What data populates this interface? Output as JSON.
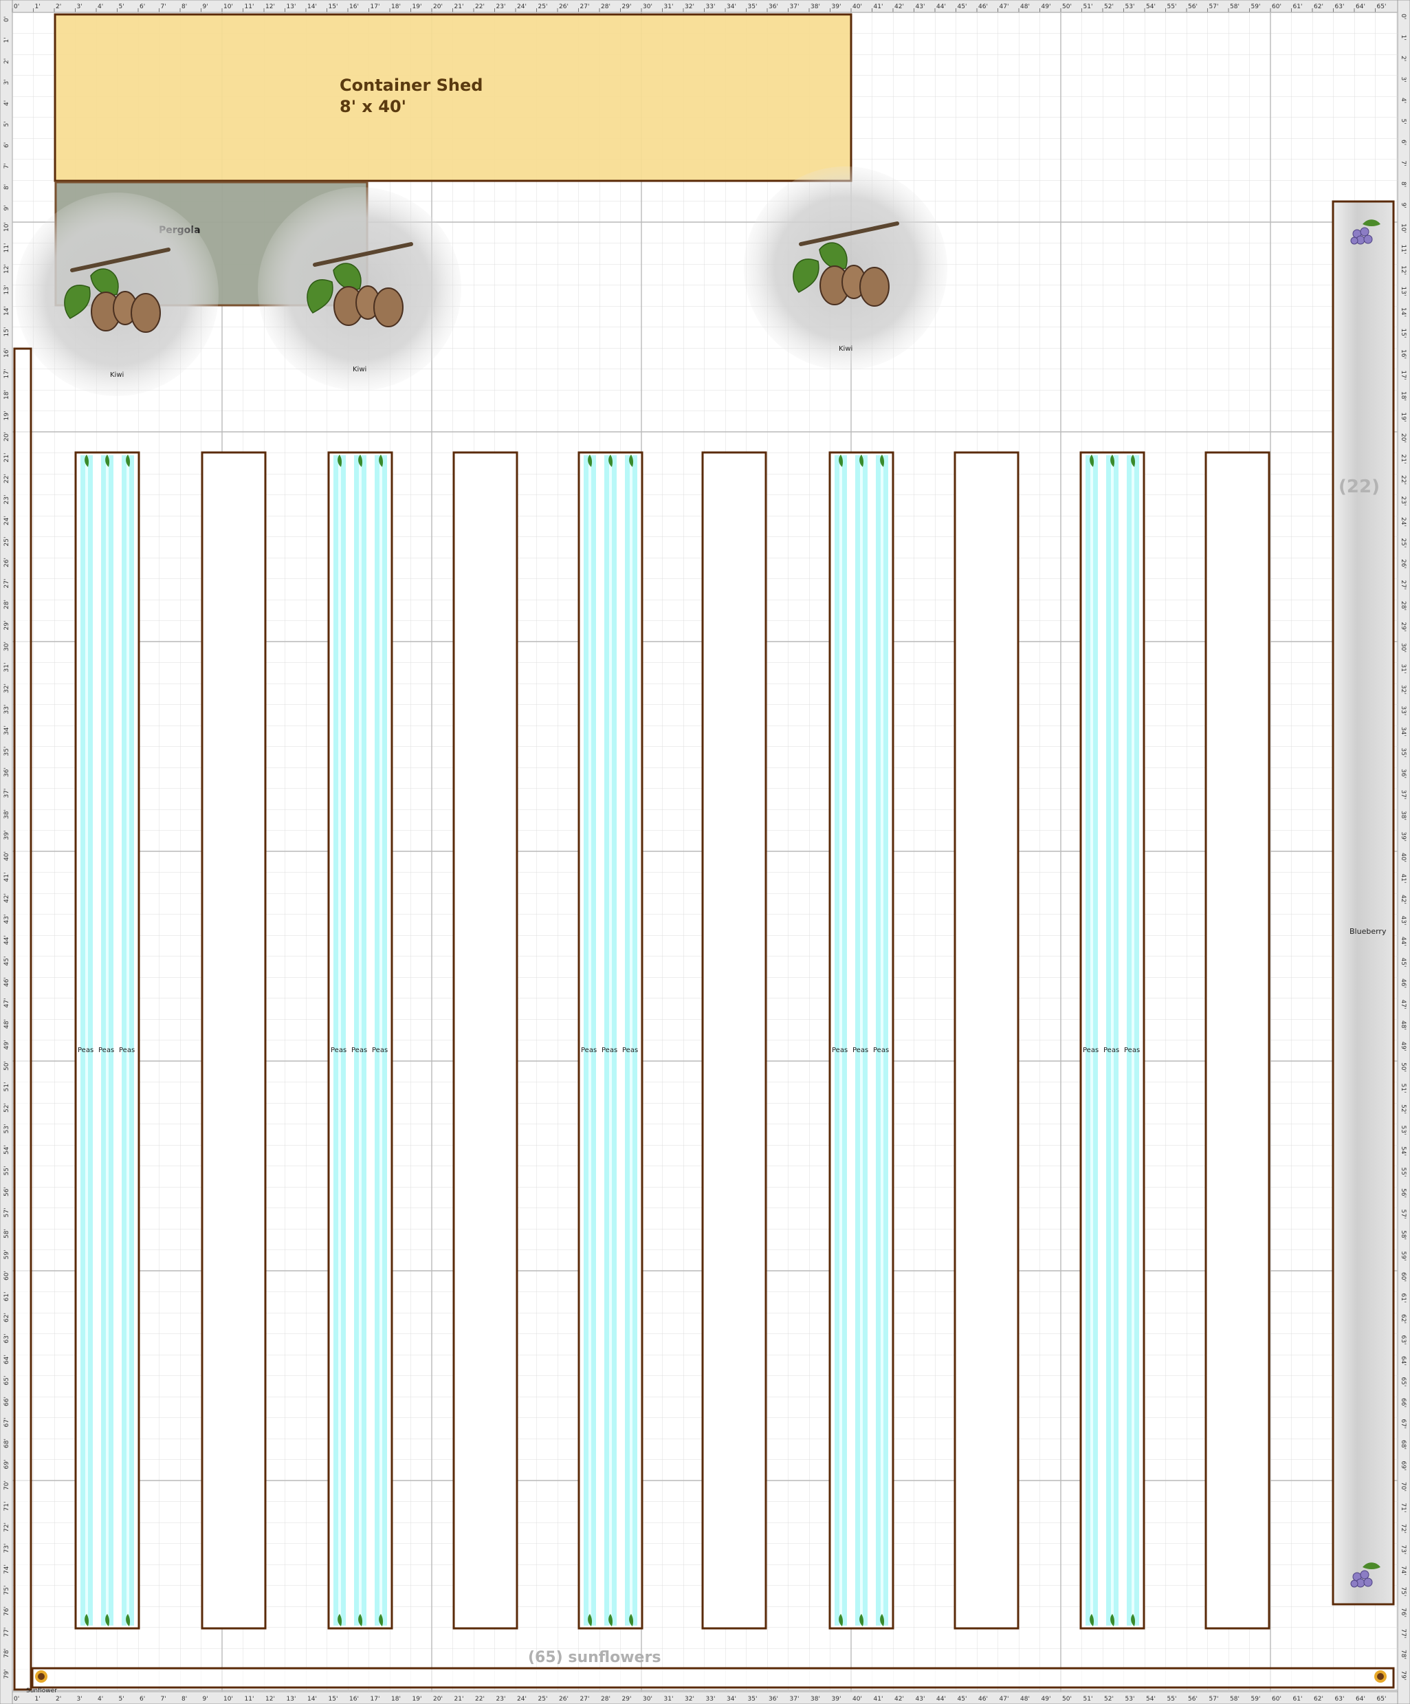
{
  "ruler": {
    "unit": "'",
    "top_ticks": [
      "0",
      "1",
      "2",
      "3",
      "4",
      "5",
      "6",
      "7",
      "8",
      "9",
      "10",
      "11",
      "12",
      "13",
      "14",
      "15",
      "16",
      "17",
      "18",
      "19",
      "20",
      "21",
      "22",
      "23",
      "24",
      "25",
      "26",
      "27",
      "28",
      "29",
      "30",
      "31",
      "32",
      "33",
      "34",
      "35",
      "36",
      "37",
      "38",
      "39",
      "40",
      "41",
      "42",
      "43",
      "44",
      "45",
      "46",
      "47",
      "48",
      "49",
      "50",
      "51",
      "52",
      "53",
      "54",
      "55",
      "56",
      "57",
      "58",
      "59",
      "60",
      "61",
      "62",
      "63",
      "64",
      "65"
    ],
    "side_ticks": [
      "0",
      "1",
      "2",
      "3",
      "4",
      "5",
      "6",
      "7",
      "8",
      "9",
      "10",
      "11",
      "12",
      "13",
      "14",
      "15",
      "16",
      "17",
      "18",
      "19",
      "20",
      "21",
      "22",
      "23",
      "24",
      "25",
      "26",
      "27",
      "28",
      "29",
      "30",
      "31",
      "32",
      "33",
      "34",
      "35",
      "36",
      "37",
      "38",
      "39",
      "40",
      "41",
      "42",
      "43",
      "44",
      "45",
      "46",
      "47",
      "48",
      "49",
      "50",
      "51",
      "52",
      "53",
      "54",
      "55",
      "56",
      "57",
      "58",
      "59",
      "60",
      "61",
      "62",
      "63",
      "64",
      "65",
      "66",
      "67",
      "68",
      "69",
      "70",
      "71",
      "72",
      "73",
      "74",
      "75",
      "76",
      "77",
      "78",
      "79"
    ]
  },
  "shed": {
    "title": "Container Shed",
    "size": "8' x 40'"
  },
  "pergola": {
    "label": "Pergola"
  },
  "kiwis": [
    {
      "label": "Kiwi"
    },
    {
      "label": "Kiwi"
    },
    {
      "label": "Kiwi"
    }
  ],
  "beds": {
    "planted_label": "Peas",
    "planted_count": 5,
    "empty_count": 5
  },
  "blueberry": {
    "label": "Blueberry",
    "count": "(22)"
  },
  "sunflowers": {
    "label": "(65) sunflowers",
    "plant_label": "Sunflower"
  },
  "colors": {
    "grid_minor": "#dcdcdc",
    "grid_major": "#b9b9b9",
    "bed_border": "#5a2a08",
    "shed_fill": "#f7dd91",
    "pergola_fill": "#a3a89a",
    "peas_stripe": "#b8f8f8",
    "blueberry_fill": "#d3d3d3",
    "kiwi_halo": "#cfcfcf"
  }
}
